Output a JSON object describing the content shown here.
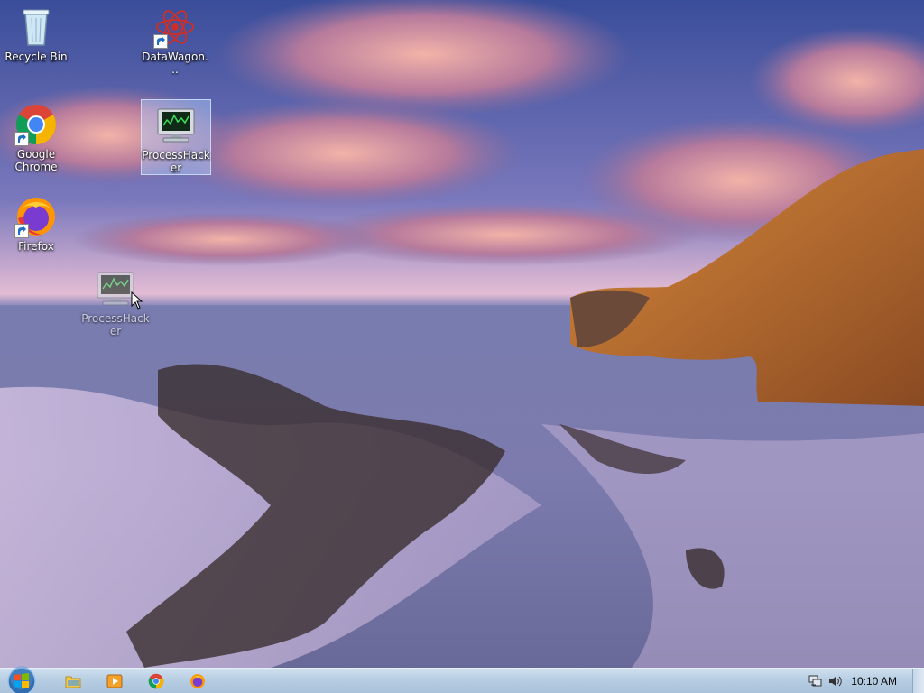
{
  "desktop": {
    "icons": [
      {
        "label": "Recycle Bin",
        "icon": "recycle-bin-icon"
      },
      {
        "label": "DataWagon...",
        "icon": "datawagon-icon"
      },
      {
        "label": "Google Chrome",
        "icon": "chrome-icon"
      },
      {
        "label": "ProcessHacker",
        "icon": "process-hacker-icon",
        "selected": true
      },
      {
        "label": "Firefox",
        "icon": "firefox-icon"
      },
      {
        "label": "ProcessHacker",
        "icon": "process-hacker-icon",
        "dragging": true
      }
    ]
  },
  "taskbar": {
    "pinned": [
      {
        "name": "Windows Explorer",
        "icon": "folder-icon"
      },
      {
        "name": "Windows Media Player",
        "icon": "media-player-icon"
      },
      {
        "name": "Google Chrome",
        "icon": "chrome-icon"
      },
      {
        "name": "Firefox",
        "icon": "firefox-icon"
      }
    ],
    "tray": {
      "clock": "10:10 AM",
      "icons": [
        "network-icon",
        "volume-icon"
      ]
    }
  },
  "colors": {
    "taskbar_top": "#cfe0ef",
    "selection": "#b4d2ff"
  }
}
